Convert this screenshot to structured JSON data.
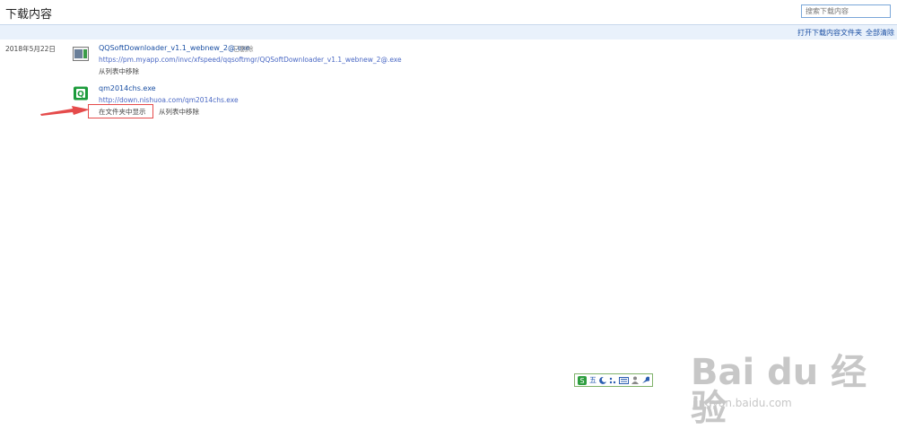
{
  "header": {
    "title": "下载内容",
    "search_placeholder": "搜索下载内容"
  },
  "toolbar": {
    "open_folder": "打开下载内容文件夹",
    "clear_all": "全部清除"
  },
  "downloads": [
    {
      "date": "2018年5月22日",
      "filename": "QQSoftDownloader_v1.1_webnew_2@.exe",
      "status": "已删除",
      "url": "https://pm.myapp.com/invc/xfspeed/qqsoftmgr/QQSoftDownloader_v1.1_webnew_2@.exe",
      "remove": "从列表中移除",
      "icon": "window-file-icon"
    },
    {
      "filename": "qm2014chs.exe",
      "url": "http://down.nishuoa.com/qm2014chs.exe",
      "show_in_folder": "在文件夹中显示",
      "remove": "从列表中移除",
      "icon": "green-q-installer-icon"
    }
  ],
  "ime_toolbar": {
    "label": "五"
  },
  "watermark": {
    "main": "Bai du 经验",
    "sub": "jingyan.baidu.com"
  },
  "colors": {
    "link": "#1a4fa3",
    "url": "#4a68c4",
    "highlight": "#e54b4b",
    "toolbar_bg": "#e9f1fb"
  }
}
